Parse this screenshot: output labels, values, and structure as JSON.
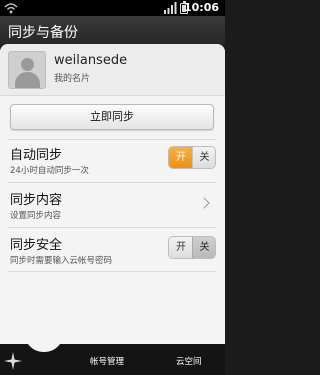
{
  "status_bar": {
    "time": "10:06"
  },
  "header": {
    "title": "同步与备份"
  },
  "profile": {
    "username": "weilansede",
    "subtitle": "我的名片"
  },
  "sync_button": {
    "label": "立即同步"
  },
  "settings": [
    {
      "title": "自动同步",
      "subtitle": "24小时自动同步一次",
      "control": "toggle",
      "on_label": "开",
      "off_label": "关",
      "state": "on"
    },
    {
      "title": "同步内容",
      "subtitle": "设置同步内容",
      "control": "chevron"
    },
    {
      "title": "同步安全",
      "subtitle": "同步时需要输入云帐号密码",
      "control": "toggle",
      "on_label": "开",
      "off_label": "关",
      "state": "off"
    }
  ],
  "tabs": [
    {
      "label": "帐号管理"
    },
    {
      "label": "云空间"
    }
  ],
  "colors": {
    "accent": "#ee9115",
    "card_bg": "#f4f4f4",
    "header_bg": "#2e2e2e"
  }
}
